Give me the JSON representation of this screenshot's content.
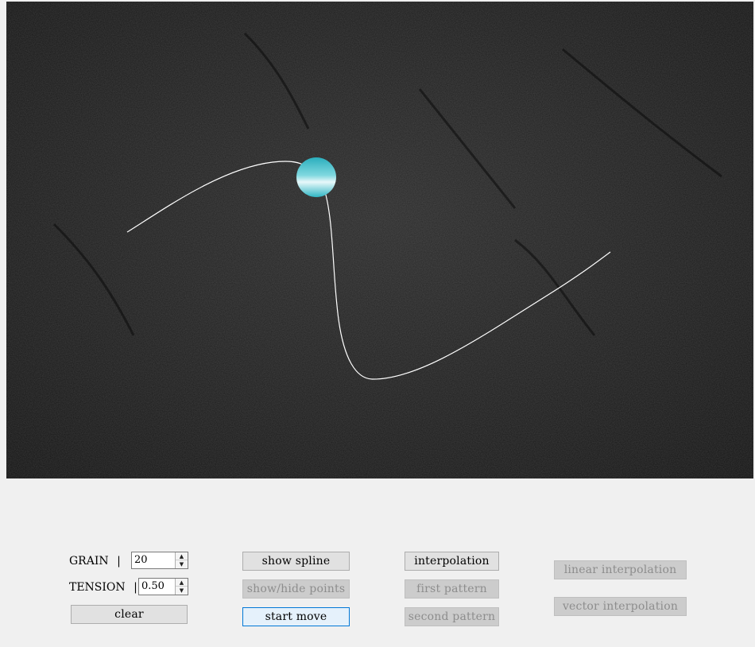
{
  "canvas": {
    "background": "#1b1b1b",
    "curve_color": "#ffffff",
    "ball_color": "#3fc1cf"
  },
  "controls": {
    "grain_label": "GRAIN",
    "grain_value": "20",
    "tension_label": "TENSION",
    "tension_value": "0.50",
    "separator": "|",
    "clear_label": "clear"
  },
  "buttons": {
    "show_spline": "show spline",
    "show_hide_points": "show/hide points",
    "start_move": "start move",
    "interpolation": "interpolation",
    "first_pattern": "first pattern",
    "second_pattern": "second pattern",
    "linear_interpolation": "linear interpolation",
    "vector_interpolation": "vector interpolation"
  }
}
